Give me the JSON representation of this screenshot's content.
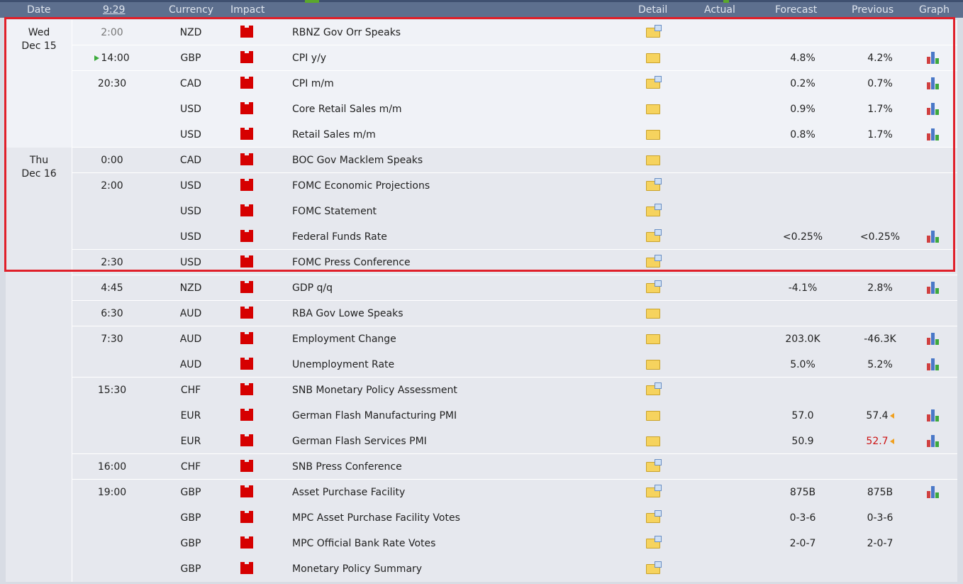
{
  "header": {
    "date": "Date",
    "time": "9:29",
    "currency": "Currency",
    "impact": "Impact",
    "detail": "Detail",
    "actual": "Actual",
    "forecast": "Forecast",
    "previous": "Previous",
    "graph": "Graph"
  },
  "days": [
    {
      "line1": "Wed",
      "line2": "Dec 15"
    },
    {
      "line1": "Thu",
      "line2": "Dec 16"
    }
  ],
  "rows": [
    {
      "time": "2:00",
      "currency": "NZD",
      "event": "RBNZ Gov Orr Speaks",
      "forecast": "",
      "previous": "",
      "graph": false,
      "detail": "doc"
    },
    {
      "time": "14:00",
      "currency": "GBP",
      "event": "CPI y/y",
      "forecast": "4.8%",
      "previous": "4.2%",
      "graph": true,
      "detail": "folder"
    },
    {
      "time": "20:30",
      "currency": "CAD",
      "event": "CPI m/m",
      "forecast": "0.2%",
      "previous": "0.7%",
      "graph": true,
      "detail": "doc"
    },
    {
      "time": "",
      "currency": "USD",
      "event": "Core Retail Sales m/m",
      "forecast": "0.9%",
      "previous": "1.7%",
      "graph": true,
      "detail": "folder"
    },
    {
      "time": "",
      "currency": "USD",
      "event": "Retail Sales m/m",
      "forecast": "0.8%",
      "previous": "1.7%",
      "graph": true,
      "detail": "folder"
    },
    {
      "time": "0:00",
      "currency": "CAD",
      "event": "BOC Gov Macklem Speaks",
      "forecast": "",
      "previous": "",
      "graph": false,
      "detail": "folder"
    },
    {
      "time": "2:00",
      "currency": "USD",
      "event": "FOMC Economic Projections",
      "forecast": "",
      "previous": "",
      "graph": false,
      "detail": "doc"
    },
    {
      "time": "",
      "currency": "USD",
      "event": "FOMC Statement",
      "forecast": "",
      "previous": "",
      "graph": false,
      "detail": "doc"
    },
    {
      "time": "",
      "currency": "USD",
      "event": "Federal Funds Rate",
      "forecast": "<0.25%",
      "previous": "<0.25%",
      "graph": true,
      "detail": "doc"
    },
    {
      "time": "2:30",
      "currency": "USD",
      "event": "FOMC Press Conference",
      "forecast": "",
      "previous": "",
      "graph": false,
      "detail": "doc"
    },
    {
      "time": "4:45",
      "currency": "NZD",
      "event": "GDP q/q",
      "forecast": "-4.1%",
      "previous": "2.8%",
      "graph": true,
      "detail": "doc"
    },
    {
      "time": "6:30",
      "currency": "AUD",
      "event": "RBA Gov Lowe Speaks",
      "forecast": "",
      "previous": "",
      "graph": false,
      "detail": "folder"
    },
    {
      "time": "7:30",
      "currency": "AUD",
      "event": "Employment Change",
      "forecast": "203.0K",
      "previous": "-46.3K",
      "graph": true,
      "detail": "folder"
    },
    {
      "time": "",
      "currency": "AUD",
      "event": "Unemployment Rate",
      "forecast": "5.0%",
      "previous": "5.2%",
      "graph": true,
      "detail": "folder"
    },
    {
      "time": "15:30",
      "currency": "CHF",
      "event": "SNB Monetary Policy Assessment",
      "forecast": "",
      "previous": "",
      "graph": false,
      "detail": "doc"
    },
    {
      "time": "",
      "currency": "EUR",
      "event": "German Flash Manufacturing PMI",
      "forecast": "57.0",
      "previous": "57.4",
      "graph": true,
      "detail": "folder"
    },
    {
      "time": "",
      "currency": "EUR",
      "event": "German Flash Services PMI",
      "forecast": "50.9",
      "previous": "52.7",
      "graph": true,
      "detail": "folder"
    },
    {
      "time": "16:00",
      "currency": "CHF",
      "event": "SNB Press Conference",
      "forecast": "",
      "previous": "",
      "graph": false,
      "detail": "doc"
    },
    {
      "time": "19:00",
      "currency": "GBP",
      "event": "Asset Purchase Facility",
      "forecast": "875B",
      "previous": "875B",
      "graph": true,
      "detail": "doc"
    },
    {
      "time": "",
      "currency": "GBP",
      "event": "MPC Asset Purchase Facility Votes",
      "forecast": "0-3-6",
      "previous": "0-3-6",
      "graph": false,
      "detail": "doc"
    },
    {
      "time": "",
      "currency": "GBP",
      "event": "MPC Official Bank Rate Votes",
      "forecast": "2-0-7",
      "previous": "2-0-7",
      "graph": false,
      "detail": "doc"
    },
    {
      "time": "",
      "currency": "GBP",
      "event": "Monetary Policy Summary",
      "forecast": "",
      "previous": "",
      "graph": false,
      "detail": "doc"
    }
  ],
  "colors": {
    "highlight": "#e0202a",
    "header": "#5d6f8e",
    "revised": "#cc1111"
  }
}
